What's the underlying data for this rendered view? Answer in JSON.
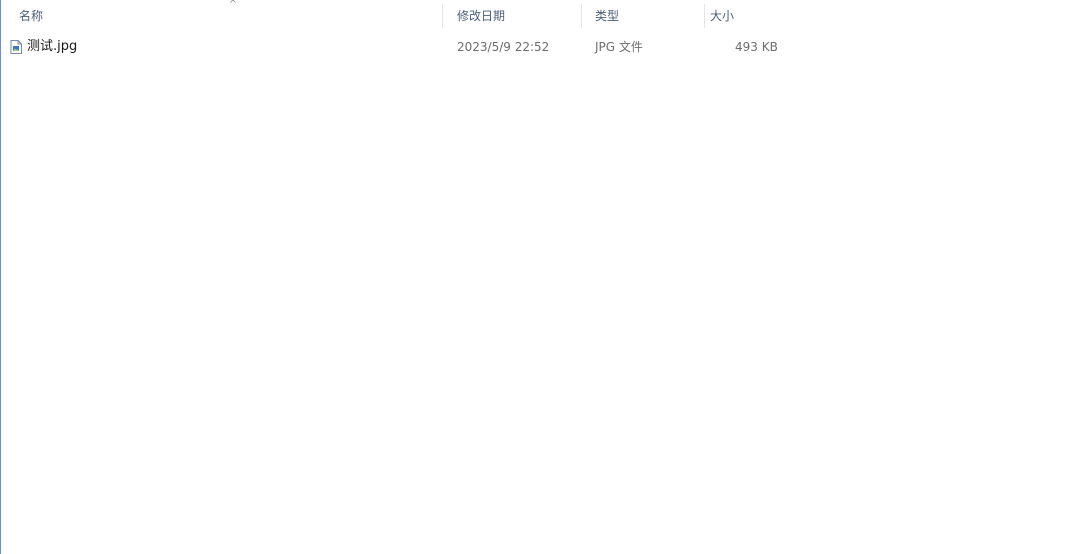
{
  "columns": {
    "name": "名称",
    "date_modified": "修改日期",
    "type": "类型",
    "size": "大小"
  },
  "sort": {
    "column": "name",
    "direction": "ascending",
    "icon": "chevron-up-icon"
  },
  "files": [
    {
      "name": "测试.jpg",
      "date_modified": "2023/5/9 22:52",
      "type": "JPG 文件",
      "size": "493 KB",
      "icon": "image-file-icon"
    }
  ],
  "colors": {
    "header_text": "#4c607a",
    "secondary_text": "#6d6d6d",
    "primary_text": "#1a1a1a",
    "left_border": "#6b8fc7"
  }
}
